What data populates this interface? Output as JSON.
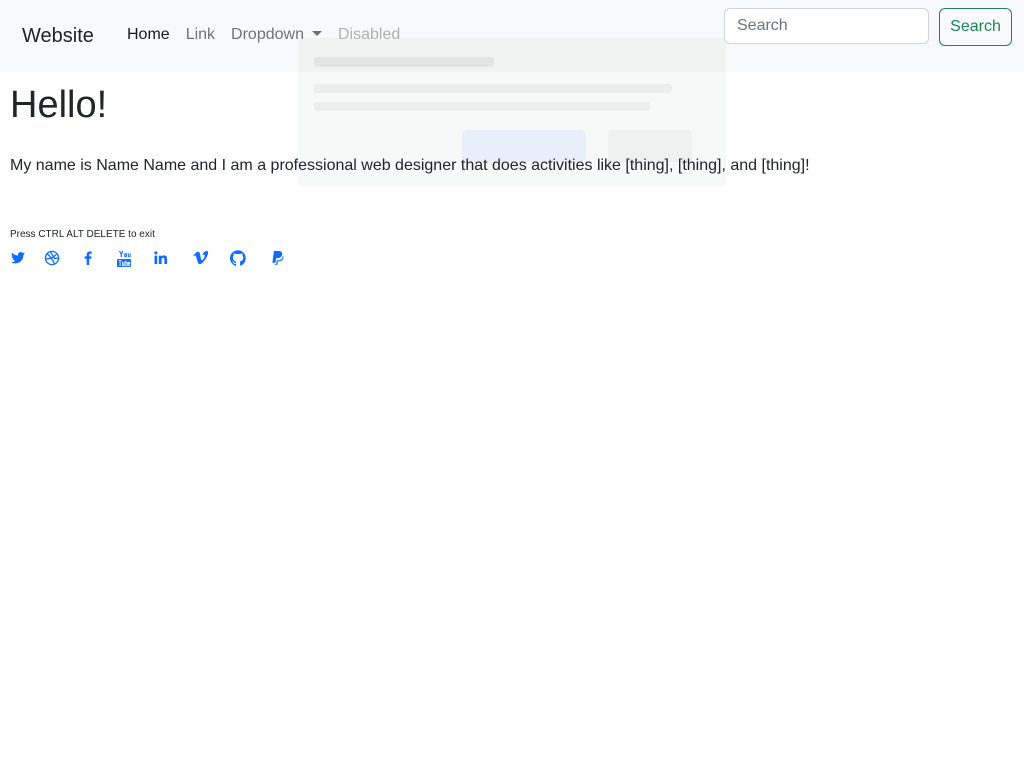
{
  "navbar": {
    "brand": "Website",
    "links": [
      {
        "label": "Home",
        "state": "active"
      },
      {
        "label": "Link",
        "state": "normal"
      },
      {
        "label": "Dropdown",
        "state": "normal",
        "has_caret": true
      },
      {
        "label": "Disabled",
        "state": "disabled"
      }
    ],
    "search": {
      "placeholder": "Search",
      "value": "",
      "button_label": "Search"
    }
  },
  "main": {
    "heading": "Hello!",
    "intro": "My name is Name Name and I am a professional web designer that does activities like [thing], [thing], and [thing]!",
    "exit_note": "Press CTRL ALT DELETE to exit"
  },
  "social_icons": [
    "twitter-icon",
    "dribbble-icon",
    "facebook-icon",
    "youtube-icon",
    "linkedin-icon",
    "vimeo-icon",
    "github-icon",
    "paypal-icon"
  ],
  "colors": {
    "navbar_bg": "#f8f9fa",
    "search_button": "#198754",
    "social_icons": "#0d6efd",
    "text": "#212529"
  }
}
